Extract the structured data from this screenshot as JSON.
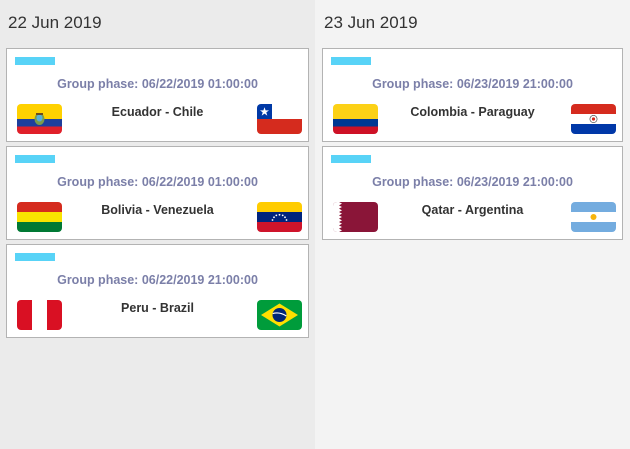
{
  "days": [
    {
      "date": "22 Jun 2019",
      "matches": [
        {
          "phase": "Group phase: 06/22/2019 01:00:00",
          "teams": "Ecuador - Chile",
          "home_flag": "ecuador-flag-icon",
          "away_flag": "chile-flag-icon"
        },
        {
          "phase": "Group phase: 06/22/2019 01:00:00",
          "teams": "Bolivia - Venezuela",
          "home_flag": "bolivia-flag-icon",
          "away_flag": "venezuela-flag-icon"
        },
        {
          "phase": "Group phase: 06/22/2019 21:00:00",
          "teams": "Peru - Brazil",
          "home_flag": "peru-flag-icon",
          "away_flag": "brazil-flag-icon"
        }
      ]
    },
    {
      "date": "23 Jun 2019",
      "matches": [
        {
          "phase": "Group phase: 06/23/2019 21:00:00",
          "teams": "Colombia - Paraguay",
          "home_flag": "colombia-flag-icon",
          "away_flag": "paraguay-flag-icon"
        },
        {
          "phase": "Group phase: 06/23/2019 21:00:00",
          "teams": "Qatar - Argentina",
          "home_flag": "qatar-flag-icon",
          "away_flag": "argentina-flag-icon"
        }
      ]
    }
  ],
  "colors": {
    "tag": "#58d3f7",
    "phase_text": "#7b7fa8",
    "card_border": "#b3b3b3",
    "left_column_bg": "#ebebeb",
    "right_column_bg": "#f3f3f3"
  }
}
